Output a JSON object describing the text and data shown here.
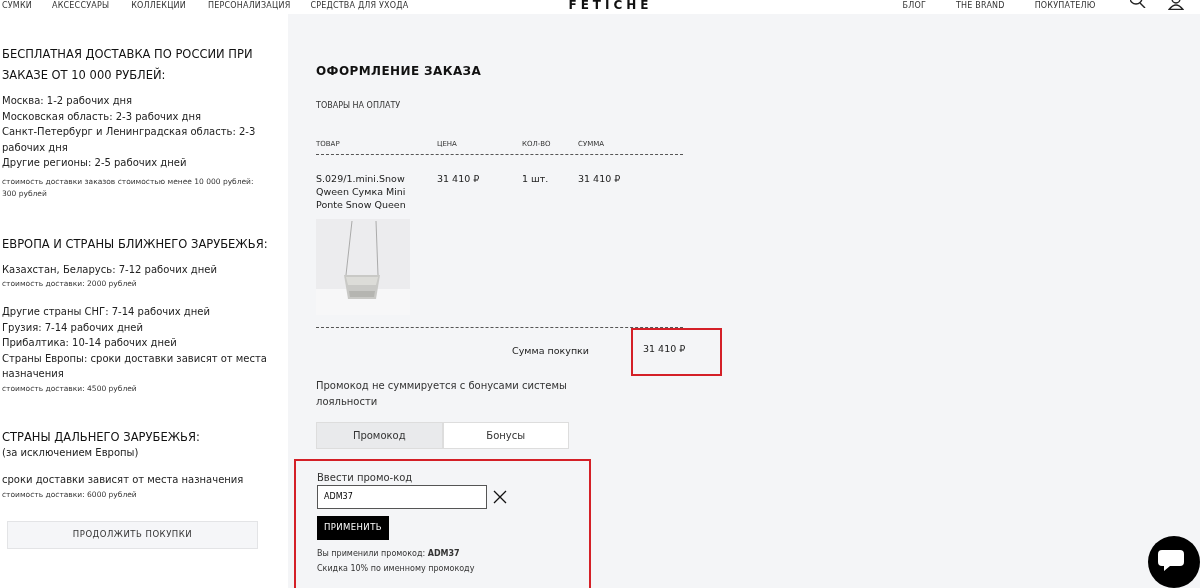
{
  "nav_left": [
    "СУМКИ",
    "АКСЕССУАРЫ",
    "КОЛЛЕКЦИИ",
    "ПЕРСОНАЛИЗАЦИЯ",
    "СРЕДСТВА ДЛЯ УХОДА"
  ],
  "logo": "FETICHE",
  "nav_right": [
    "БЛОГ",
    "THE BRAND",
    "ПОКУПАТЕЛЮ"
  ],
  "delivery": [
    {
      "heading": "БЕСПЛАТНАЯ ДОСТАВКА ПО РОССИИ ПРИ ЗАКАЗЕ ОТ 10 000 РУБЛЕЙ:",
      "lines": [
        "Москва: 1-2 рабочих дня",
        "Московская область: 2-3 рабочих дня",
        "Санкт-Петербург и Ленинградская область: 2-3 рабочих дня",
        "Другие регионы: 2-5 рабочих дней"
      ],
      "note": "стоимость доставки заказов стоимостью менее 10 000 рублей: 300 рублей"
    },
    {
      "heading": "ЕВРОПА И СТРАНЫ БЛИЖНЕГО ЗАРУБЕЖЬЯ:",
      "lines": [
        "Казахстан, Беларусь: 7-12 рабочих дней"
      ],
      "note": "стоимость доставки: 2000 рублей",
      "lines2": [
        "Другие страны СНГ: 7-14 рабочих дней",
        "Грузия: 7-14 рабочих дней",
        "Прибалтика: 10-14 рабочих дней",
        "Страны Европы: сроки доставки зависят от места назначения"
      ],
      "note2": "стоимость доставки: 4500 рублей"
    },
    {
      "heading": "СТРАНЫ ДАЛЬНЕГО ЗАРУБЕЖЬЯ:",
      "subheading": "(за исключением Европы)",
      "lines": [
        "сроки доставки зависят от места назначения"
      ],
      "note": "стоимость доставки: 6000 рублей"
    }
  ],
  "continue_button": "ПРОДОЛЖИТЬ ПОКУПКИ",
  "title": "ОФОРМЛЕНИЕ ЗАКАЗА",
  "subtitle": "ТОВАРЫ НА ОПЛАТУ",
  "table": {
    "columns": [
      "ТОВАР",
      "ЦЕНА",
      "КОЛ-ВО",
      "СУММА"
    ],
    "rows": [
      {
        "name": "S.029/1.mini.Snow Qween Сумка Mini Ponte Snow Queen",
        "price": "31 410 ₽",
        "qty": "1 шт.",
        "sum": "31 410 ₽"
      }
    ]
  },
  "total": {
    "label": "Сумма покупки",
    "value": "31 410 ₽",
    "highlighted": true
  },
  "promo_note": "Промокод не суммируется с бонусами системы лояльности",
  "tabs": [
    {
      "label": "Промокод",
      "selected": true
    },
    {
      "label": "Бонусы",
      "selected": false
    }
  ],
  "promo": {
    "highlighted": true,
    "label": "Ввести промо-код",
    "value": "ADM37",
    "button": "ПРИМЕНИТЬ",
    "applied": "Вы применили промокод: **ADM37**",
    "discount": "Скидка 10% по именному промокоду"
  }
}
